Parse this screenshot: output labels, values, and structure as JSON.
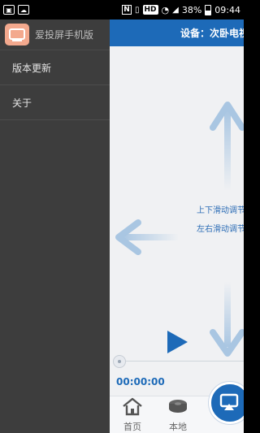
{
  "status_bar": {
    "battery_text": "38%",
    "time": "09:44",
    "hd_label": "HD",
    "nfc_label": "N"
  },
  "drawer": {
    "app_name": "爱投屏手机版",
    "items": [
      {
        "label": "版本更新"
      },
      {
        "label": "关于"
      }
    ]
  },
  "main": {
    "device_label": "设备：次卧电视",
    "hint_updown": "上下滑动调节",
    "hint_leftright": "左右滑动调节",
    "time": "00:00:00",
    "tabs": [
      {
        "label": "首页"
      },
      {
        "label": "本地"
      }
    ]
  },
  "colors": {
    "brand_blue": "#1d6ab8",
    "drawer_bg": "#3d3d3d",
    "app_icon": "#f3a98e"
  }
}
